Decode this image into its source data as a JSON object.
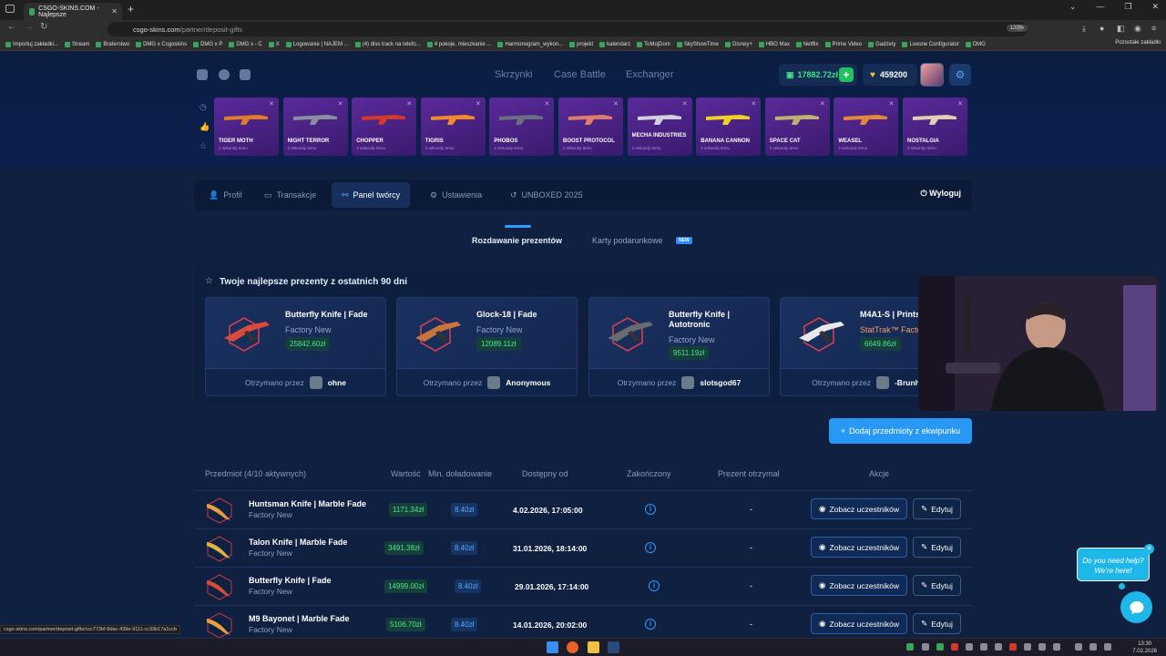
{
  "browser": {
    "tab_title": "CSGO-SKINS.COM - Najlepsze",
    "url_host": "csgo-skins.com",
    "url_path": "/partner/deposit-gifts",
    "zoom": "120%",
    "bookmarks": [
      "Importuj zakładki...",
      "Stream",
      "Braterstwo",
      "DMG x Csgoskins",
      "DMG x P",
      "DMG x - C",
      "X",
      "Logowanie | NAJEM ...",
      "(4) diss track na telefo...",
      "4 pokoje, mieszkanie ...",
      "Harmonogram_wykon...",
      "projekt",
      "kalendarz",
      "ToMojDom",
      "SkyShowTime",
      "Disney+",
      "HBO Max",
      "Netflix",
      "Prime Video",
      "Gadżety",
      "Loxone Configurator",
      "DMG"
    ],
    "bookmarks_other": "Pozostałe zakładki",
    "status_url": "csgo-skins.com/partner/deposit-gifts/ccc773bf-8dac-439e-9111-cc33b17a1ccb"
  },
  "header": {
    "nav": [
      "Skrzynki",
      "Case Battle",
      "Exchanger"
    ],
    "balance": "17882.72zł",
    "coins": "459200"
  },
  "cases": [
    {
      "name": "TIGER MOTH",
      "sub": "2 sekundy temu",
      "color": "#e07b2a"
    },
    {
      "name": "NIGHT TERROR",
      "sub": "2 sekundy temu",
      "color": "#8a8fa0"
    },
    {
      "name": "CHOPPER",
      "sub": "2 sekundy temu",
      "color": "#d23a2a"
    },
    {
      "name": "TIGRIS",
      "sub": "2 sekundy temu",
      "color": "#f08a2a"
    },
    {
      "name": "PHOBOS",
      "sub": "2 sekundy temu",
      "color": "#6a7080"
    },
    {
      "name": "BOOST PROTOCOL",
      "sub": "2 sekundy temu",
      "color": "#e07a6a"
    },
    {
      "name": "MECHA INDUSTRIES",
      "sub": "2 sekundy temu",
      "color": "#d0d0e0"
    },
    {
      "name": "BANANA CANNON",
      "sub": "2 sekundy temu",
      "color": "#f2d020"
    },
    {
      "name": "SPACE CAT",
      "sub": "2 sekundy temu",
      "color": "#c0b070"
    },
    {
      "name": "WEASEL",
      "sub": "2 sekundy temu",
      "color": "#e08a3a"
    },
    {
      "name": "NOSTALGIA",
      "sub": "2 sekundy temu",
      "color": "#e0d0b0"
    }
  ],
  "profile_tabs": [
    "Profil",
    "Transakcje",
    "Panel twórcy",
    "Ustawienia",
    "UNBOXED 2025"
  ],
  "logout": "Wyloguj",
  "subtabs": {
    "gifts": "Rozdawanie prezentów",
    "cards": "Karty podarunkowe",
    "new_badge": "NEW"
  },
  "best_gifts": {
    "title": "Twoje najlepsze prezenty z ostatnich 90 dni",
    "received_label": "Otrzymano przez",
    "items": [
      {
        "name": "Butterfly Knife | Fade",
        "cond": "Factory New",
        "price": "25842.60zł",
        "user": "ohne",
        "color": "#d84a3a"
      },
      {
        "name": "Glock-18 | Fade",
        "cond": "Factory New",
        "price": "12089.11zł",
        "user": "Anonymous",
        "color": "#c8743a"
      },
      {
        "name": "Butterfly Knife | Autotronic",
        "cond": "Factory New",
        "price": "9511.19zł",
        "user": "slotsgod67",
        "color": "#6a6a72"
      },
      {
        "name": "M4A1-S | Printstream",
        "cond": "StatTrak™ Factory New",
        "price": "6649.86zł",
        "user": "-Brunhild",
        "color": "#e8e8ea"
      }
    ]
  },
  "add_button": "Dodaj przedmioty z ekwipunku",
  "table": {
    "headers": [
      "Przedmiot (4/10 aktywnych)",
      "Wartość",
      "Min. doładowanie",
      "Dostępny od",
      "Zakończony",
      "Prezent otrzymał",
      "Akcje"
    ],
    "rows": [
      {
        "name": "Huntsman Knife | Marble Fade",
        "cond": "Factory New",
        "value": "1171.34zł",
        "min": "8.40zł",
        "date": "4.02.2026, 17:05:00",
        "received": "-",
        "color": "#e8a040"
      },
      {
        "name": "Talon Knife | Marble Fade",
        "cond": "Factory New",
        "value": "3491.38zł",
        "min": "8.40zł",
        "date": "31.01.2026, 18:14:00",
        "received": "-",
        "color": "#e0b040"
      },
      {
        "name": "Butterfly Knife | Fade",
        "cond": "Factory New",
        "value": "14999.00zł",
        "min": "8.40zł",
        "date": "29.01.2026, 17:14:00",
        "received": "-",
        "color": "#d84a3a"
      },
      {
        "name": "M9 Bayonet | Marble Fade",
        "cond": "Factory New",
        "value": "5106.70zł",
        "min": "8.40zł",
        "date": "14.01.2026, 20:02:00",
        "received": "-",
        "color": "#e8a040"
      }
    ],
    "view_label": "Zobacz uczestników",
    "edit_label": "Edytuj"
  },
  "chat": {
    "line1": "Do you need help?",
    "line2": "We're here!"
  },
  "taskbar": {
    "time": "13:30",
    "date": "7.02.2026"
  }
}
